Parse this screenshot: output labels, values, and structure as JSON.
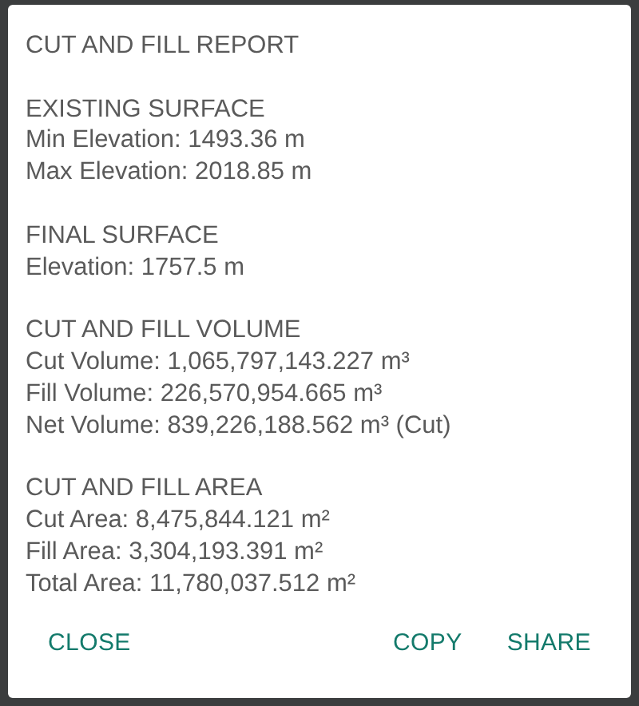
{
  "dialog": {
    "title": "CUT AND FILL REPORT",
    "sections": [
      {
        "heading": "EXISTING SURFACE",
        "lines": [
          "Min Elevation: 1493.36 m",
          "Max Elevation: 2018.85 m"
        ]
      },
      {
        "heading": "FINAL SURFACE",
        "lines": [
          "Elevation: 1757.5 m"
        ]
      },
      {
        "heading": "CUT AND FILL VOLUME",
        "lines": [
          "Cut Volume: 1,065,797,143.227 m³",
          "Fill Volume: 226,570,954.665 m³",
          "Net Volume: 839,226,188.562 m³ (Cut)"
        ]
      },
      {
        "heading": "CUT AND FILL AREA",
        "lines": [
          "Cut Area: 8,475,844.121 m²",
          "Fill Area: 3,304,193.391 m²",
          "Total Area: 11,780,037.512 m²"
        ]
      }
    ],
    "buttons_left": [
      "CLOSE"
    ],
    "buttons_right": [
      "COPY",
      "SHARE"
    ]
  }
}
